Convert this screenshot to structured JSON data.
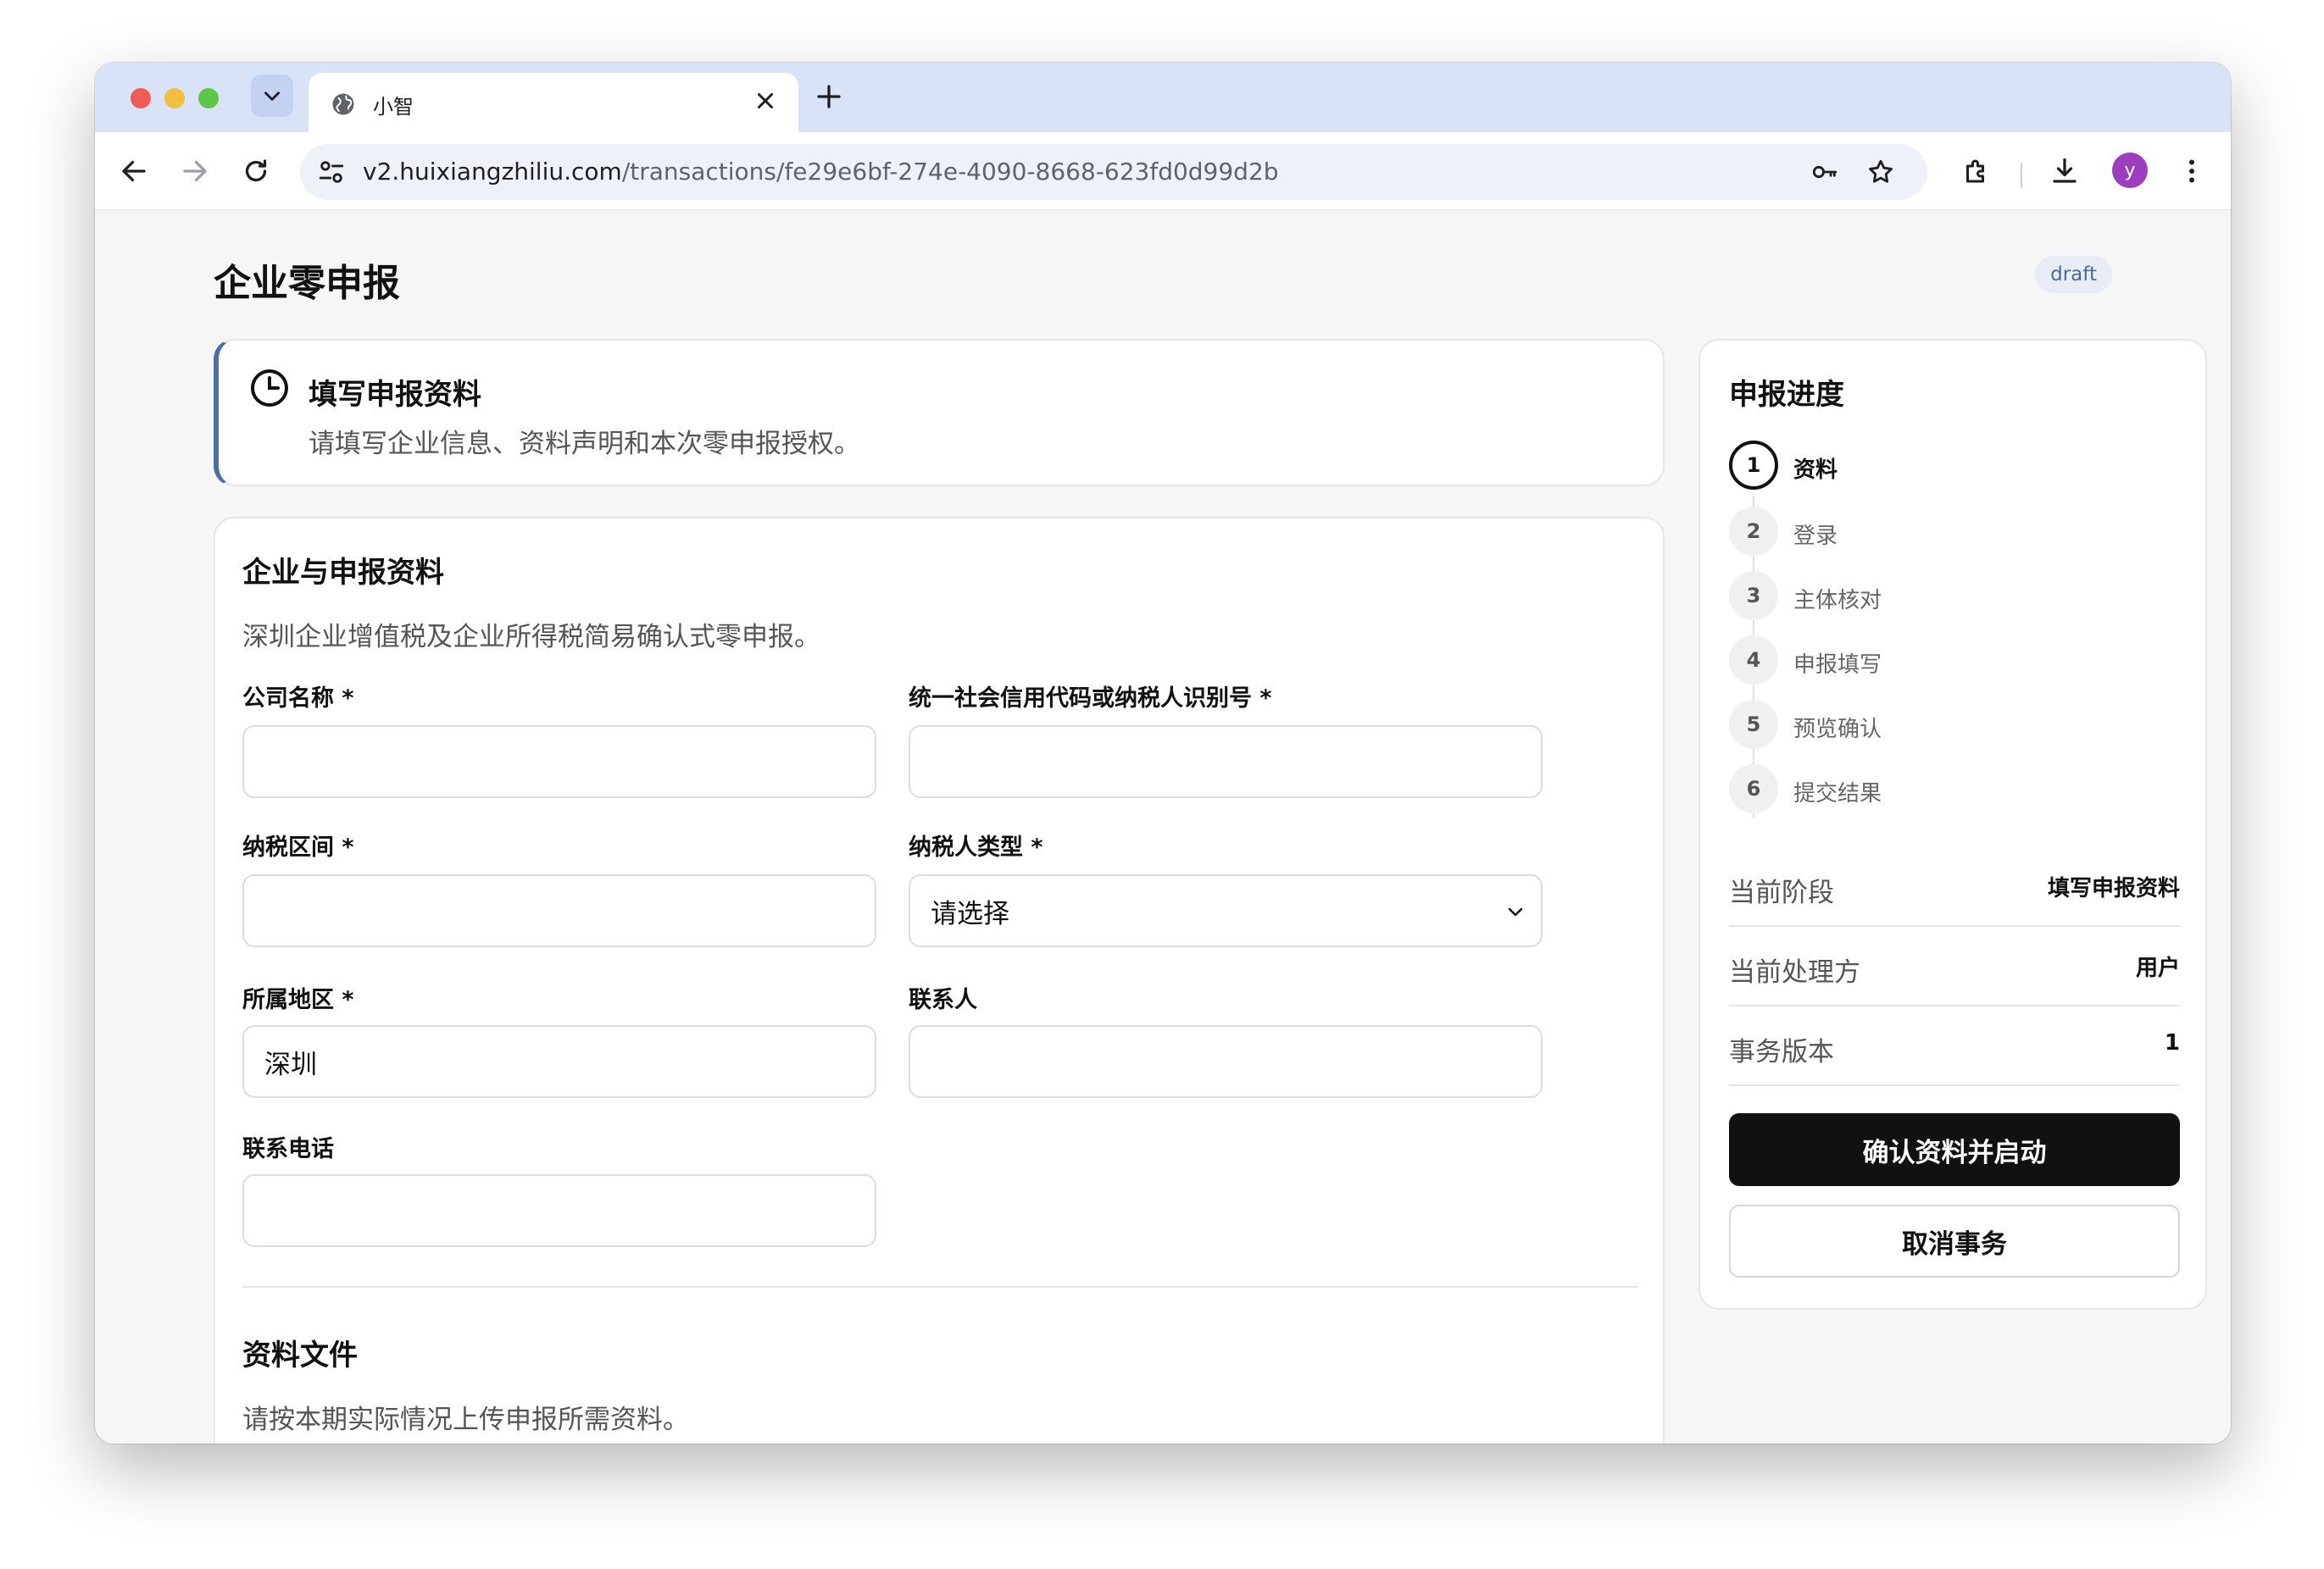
{
  "browser": {
    "tab_title": "小智",
    "url_host": "v2.huixiangzhiliu.com",
    "url_path": "/transactions/fe29e6bf-274e-4090-8668-623fd0d99d2b",
    "avatar_letter": "y",
    "icons": [
      "chevron-down-icon",
      "globe-icon",
      "close-icon",
      "plus-icon",
      "back-arrow-icon",
      "forward-arrow-icon",
      "reload-icon",
      "site-settings-icon",
      "password-key-icon",
      "star-icon",
      "extensions-icon",
      "download-icon",
      "more-vertical-icon"
    ]
  },
  "page": {
    "title": "企业零申报",
    "status_badge": "draft"
  },
  "status_card": {
    "title": "填写申报资料",
    "description": "请填写企业信息、资料声明和本次零申报授权。",
    "icon": "clock-icon"
  },
  "form": {
    "section_title": "企业与申报资料",
    "section_desc": "深圳企业增值税及企业所得税简易确认式零申报。",
    "fields": {
      "company_name": {
        "label": "公司名称 *",
        "value": ""
      },
      "credit_code": {
        "label": "统一社会信用代码或纳税人识别号 *",
        "value": ""
      },
      "tax_period": {
        "label": "纳税区间 *",
        "value": ""
      },
      "taxpayer_type": {
        "label": "纳税人类型 *",
        "value": "请选择"
      },
      "region": {
        "label": "所属地区 *",
        "value": "深圳"
      },
      "contact_person": {
        "label": "联系人",
        "value": ""
      },
      "contact_phone": {
        "label": "联系电话",
        "value": ""
      }
    },
    "files_title": "资料文件",
    "files_desc": "请按本期实际情况上传申报所需资料。"
  },
  "sidebar": {
    "title": "申报进度",
    "steps": [
      {
        "num": "1",
        "label": "资料",
        "active": true
      },
      {
        "num": "2",
        "label": "登录",
        "active": false
      },
      {
        "num": "3",
        "label": "主体核对",
        "active": false
      },
      {
        "num": "4",
        "label": "申报填写",
        "active": false
      },
      {
        "num": "5",
        "label": "预览确认",
        "active": false
      },
      {
        "num": "6",
        "label": "提交结果",
        "active": false
      }
    ],
    "info": [
      {
        "key": "当前阶段",
        "value": "填写申报资料"
      },
      {
        "key": "当前处理方",
        "value": "用户"
      },
      {
        "key": "事务版本",
        "value": "1"
      }
    ],
    "primary_button": "确认资料并启动",
    "secondary_button": "取消事务"
  },
  "colors": {
    "accent_border": "#4b6fa5",
    "primary_button": "#111111",
    "tab_strip": "#d8e3f8",
    "avatar": "#9c3fbf"
  }
}
